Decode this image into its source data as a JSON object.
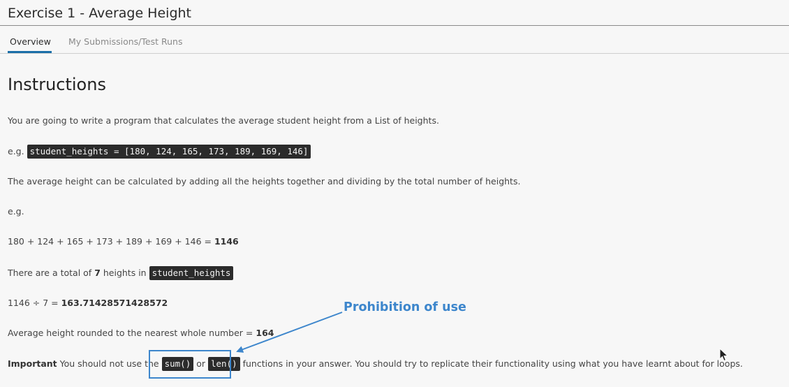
{
  "page": {
    "title": "Exercise 1 - Average Height",
    "tabs": [
      {
        "label": "Overview",
        "active": true
      },
      {
        "label": "My Submissions/Test Runs",
        "active": false
      }
    ]
  },
  "instructions": {
    "heading": "Instructions",
    "intro": "You are going to write a program that calculates the average student height from a List of heights.",
    "example_prefix": "e.g.",
    "example_code": "student_heights = [180, 124, 165, 173, 189, 169, 146]",
    "explanation": "The average height can be calculated by adding all the heights together and dividing by the total number of heights.",
    "eg_label": "e.g.",
    "sum_expression": "180 + 124 + 165 + 173 + 189 + 169 + 146 = ",
    "sum_result": "1146",
    "count_prefix": "There are a total of ",
    "count_value": "7",
    "count_middle": " heights in ",
    "count_code": "student_heights",
    "division_expression": "1146 ÷ 7 = ",
    "division_result": "163.71428571428572",
    "rounded_text": "Average height rounded to the nearest whole number = ",
    "rounded_value": "164",
    "important_label": "Important",
    "important_pre": " You should not use the ",
    "important_code1": "sum()",
    "important_or": " or ",
    "important_code2": "len()",
    "important_post": " functions in your answer. You should try to replicate their functionality using what you have learnt about for loops."
  },
  "annotation": {
    "label": "Prohibition of use",
    "color": "#3d86cc"
  },
  "icons": {
    "cursor": "mouse-pointer-icon"
  }
}
